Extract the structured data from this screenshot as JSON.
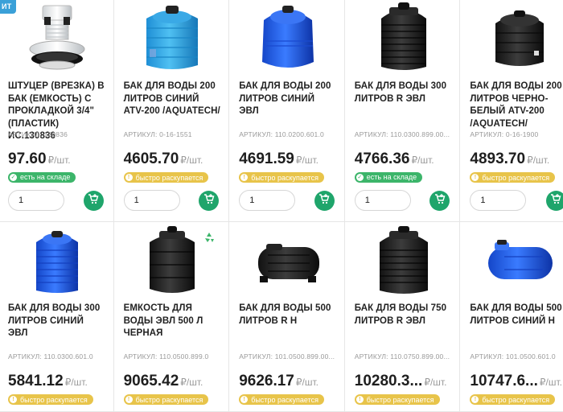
{
  "top_tag": "ИТ",
  "products": [
    {
      "title": "ШТУЦЕР (ВРЕЗКА) В БАК (ЕМКОСТЬ) С ПРОКЛАДКОЙ 3/4\" (ПЛАСТИК) ИС.130836",
      "sku": "АРТИКУЛ: 130836",
      "price": "97.60",
      "unit": "₽/шт.",
      "badge": "есть на складе",
      "badge_type": "green",
      "qty": "1",
      "image": "fitting-white",
      "eco": false
    },
    {
      "title": "БАК ДЛЯ ВОДЫ 200 ЛИТРОВ СИНИЙ ATV-200 /AQUATECH/",
      "sku": "АРТИКУЛ: 0-16-1551",
      "price": "4605.70",
      "unit": "₽/шт.",
      "badge": "быстро раскупается",
      "badge_type": "yellow",
      "qty": "1",
      "image": "tank-lightblue",
      "eco": false
    },
    {
      "title": "БАК ДЛЯ ВОДЫ 200 ЛИТРОВ СИНИЙ ЭВЛ",
      "sku": "АРТИКУЛ: 110.0200.601.0",
      "price": "4691.59",
      "unit": "₽/шт.",
      "badge": "быстро раскупается",
      "badge_type": "yellow",
      "qty": "1",
      "image": "tank-blue-round",
      "eco": false
    },
    {
      "title": "БАК ДЛЯ ВОДЫ 300 ЛИТРОВ R ЭВЛ",
      "sku": "АРТИКУЛ: 110.0300.899.00...",
      "price": "4766.36",
      "unit": "₽/шт.",
      "badge": "есть на складе",
      "badge_type": "green",
      "qty": "1",
      "image": "tank-black-ribbed",
      "eco": false
    },
    {
      "title": "БАК ДЛЯ ВОДЫ 200 ЛИТРОВ ЧЕРНО-БЕЛЫЙ ATV-200 /AQUATECH/",
      "sku": "АРТИКУЛ: 0-16-1900",
      "price": "4893.70",
      "unit": "₽/шт.",
      "badge": "быстро раскупается",
      "badge_type": "yellow",
      "qty": "1",
      "image": "tank-black-aquatech",
      "eco": false
    },
    {
      "title": "БАК ДЛЯ ВОДЫ 300 ЛИТРОВ СИНИЙ ЭВЛ",
      "sku": "АРТИКУЛ: 110.0300.601.0",
      "price": "5841.12",
      "unit": "₽/шт.",
      "badge": "быстро раскупается",
      "badge_type": "yellow",
      "qty": "1",
      "image": "tank-blue-ribbed",
      "eco": false
    },
    {
      "title": "ЕМКОСТЬ ДЛЯ ВОДЫ ЭВЛ 500 Л ЧЕРНАЯ",
      "sku": "АРТИКУЛ: 110.0500.899.0",
      "price": "9065.42",
      "unit": "₽/шт.",
      "badge": "быстро раскупается",
      "badge_type": "yellow",
      "qty": "1",
      "image": "tank-black-500",
      "eco": true
    },
    {
      "title": "БАК ДЛЯ ВОДЫ 500 ЛИТРОВ R H",
      "sku": "АРТИКУЛ: 101.0500.899.00...",
      "price": "9626.17",
      "unit": "₽/шт.",
      "badge": "быстро раскупается",
      "badge_type": "yellow",
      "qty": "1",
      "image": "tank-black-horizontal",
      "eco": false
    },
    {
      "title": "БАК ДЛЯ ВОДЫ 750 ЛИТРОВ R ЭВЛ",
      "sku": "АРТИКУЛ: 110.0750.899.00...",
      "price": "10280.3...",
      "unit": "₽/шт.",
      "badge": "быстро раскупается",
      "badge_type": "yellow",
      "qty": "1",
      "image": "tank-black-750",
      "eco": false
    },
    {
      "title": "БАК ДЛЯ ВОДЫ 500 ЛИТРОВ СИНИЙ H",
      "sku": "АРТИКУЛ: 101.0500.601.0",
      "price": "10747.6...",
      "unit": "₽/шт.",
      "badge": "быстро раскупается",
      "badge_type": "yellow",
      "qty": "1",
      "image": "tank-blue-horizontal",
      "eco": false
    }
  ],
  "colors": {
    "green": "#3cb56a",
    "yellow": "#e8c44a",
    "cart": "#1fa56b",
    "tag": "#3aa0d8"
  }
}
